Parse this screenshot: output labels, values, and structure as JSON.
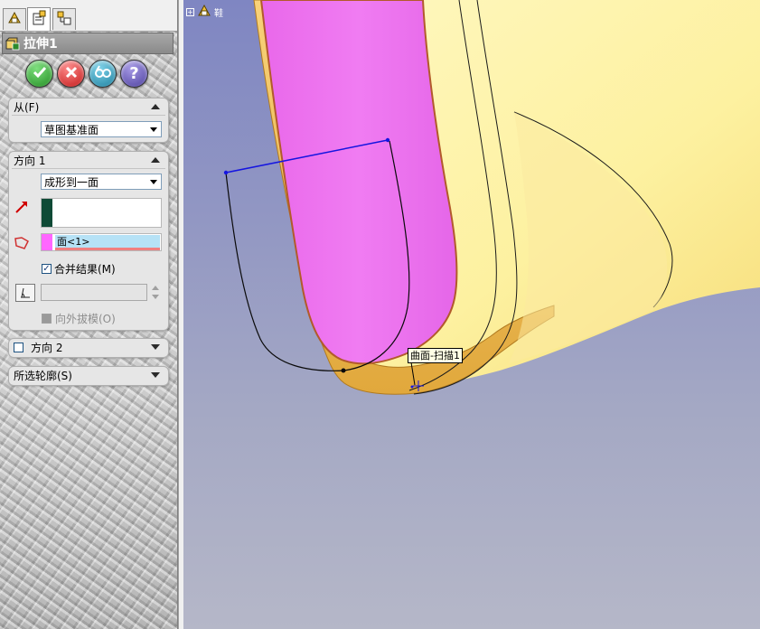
{
  "feature": {
    "title": "拉伸1"
  },
  "from_group": {
    "label": "从(F)",
    "selected": "草图基准面"
  },
  "direction1": {
    "label": "方向 1",
    "end_condition": "成形到一面",
    "face_selection": "面<1>",
    "merge_label": "合并结果(M)",
    "merge_checked": "✓",
    "draft_label": "向外拔模(O)"
  },
  "direction2": {
    "label": "方向 2"
  },
  "contours": {
    "label": "所选轮廓(S)"
  },
  "viewport": {
    "tooltip": "曲面-扫描1",
    "tree_label": "鞋"
  },
  "colors": {
    "ok": "#2e9b2e",
    "cancel": "#d92020",
    "preview": "#1f8aa8",
    "help": "#5a4fa8",
    "surface_yellow": "#fdf3a3",
    "surface_magenta": "#ee78ee",
    "sketch_blue": "#1515e0"
  },
  "icons": {
    "feature_manager": "feature-manager-icon",
    "property_manager": "property-manager-icon",
    "config_manager": "configuration-manager-icon"
  }
}
